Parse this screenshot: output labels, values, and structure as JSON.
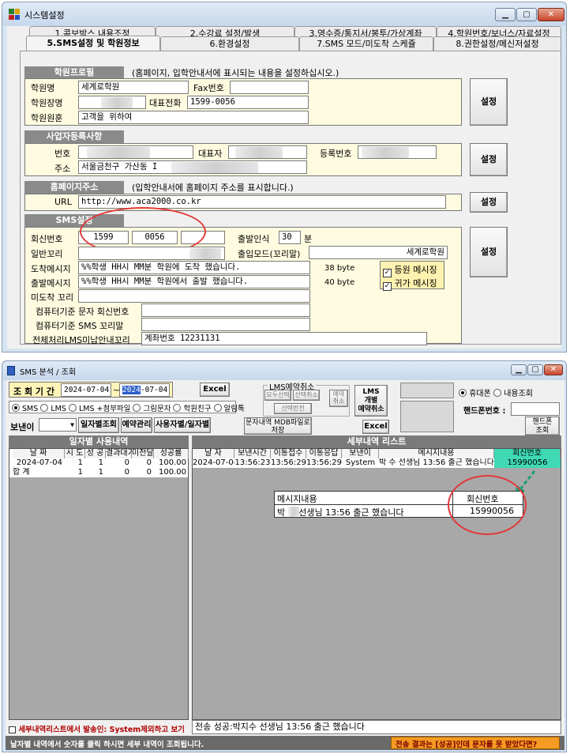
{
  "win1": {
    "title": "시스템설정",
    "tabs_row1": [
      "1.콤보박스 내용조정",
      "2.수강료 설정/발생",
      "3.영수증/통지서/봉투/가상계좌",
      "4.학원번호/보너스/자료설정"
    ],
    "tabs_row2": [
      "5.SMS설정 및 학원정보",
      "6.환경설정",
      "7.SMS 모드/미도착 스케쥴",
      "8.권한설정/메신저설정"
    ],
    "academy": {
      "header": "학원프로필",
      "note": "(홈페이지, 입학안내서에 표시되는 내용을 설정하십시오.)",
      "name_label": "학원명",
      "name_value": "세계로학원",
      "fax_label": "Fax번호",
      "fax_value": "",
      "director_label": "학원장명",
      "phone_label": "대표전화",
      "phone_value": "1599-0056",
      "motto_label": "학원원훈",
      "motto_value": "고객을 위하여",
      "button": "설정"
    },
    "business": {
      "header": "사업자등록사항",
      "number_label": "번호",
      "rep_label": "대표자",
      "reg_label": "등록번호",
      "addr_label": "주소",
      "addr_value": "서울금천구 가산동 I",
      "button": "설정"
    },
    "homepage": {
      "header": "홈페이지주소",
      "note": "(입학안내서에 홈페이지 주소를 표시합니다.)",
      "url_label": "URL",
      "url_value": "http://www.aca2000.co.kr",
      "button": "설정"
    },
    "sms": {
      "header": "SMS설정",
      "callback_label": "회신번호",
      "callback_1": "1599",
      "callback_2": "0056",
      "callback_3": "",
      "out_label": "출발인식",
      "out_value": "30",
      "out_unit": "분",
      "tail_label": "일반꼬리",
      "mode_label": "출입모드(꼬리말)",
      "mode_value": "세계로학원",
      "arrive_label": "도착메시지",
      "arrive_value": "%%학생 HH시 MM분 학원에 도착 했습니다.",
      "arrive_bytes": "38 byte",
      "depart_label": "출발메시지",
      "depart_value": "%%학생 HH시 MM분 학원에서 출발 했습니다.",
      "depart_bytes": "40 byte",
      "check1": "등원 메시징",
      "check2": "귀가 메시징",
      "late_label": "미도착 꼬리",
      "pc_callback_label": "컴퓨터기준 문자 회신번호",
      "pc_tail_label": "컴퓨터기준 SMS 꼬리말",
      "lms_label": "전체처리LMS미납안내꼬리",
      "lms_value": "계좌번호 12231131",
      "button": "설정"
    }
  },
  "win2": {
    "title": "SMS 분석 / 조회",
    "period_label": "조 회 기 간",
    "date_from": "2024-07-04",
    "tilde": "~",
    "date_to_sel": "2024",
    "date_to_rest": "-07-04",
    "excel1": "Excel",
    "lms_group": "LMS예약취소",
    "btn_select_all": "모두선택",
    "btn_select_cancel": "선택취소",
    "btn_reserve_cancel": "예약\n취소",
    "btn_select_reverse": "선택반전",
    "btn_lms": "LMS\n개별\n예약취소",
    "radios": [
      "SMS",
      "LMS",
      "LMS +첨부파일",
      "그림문자",
      "학원친구",
      "알림톡"
    ],
    "sender_label": "보낸이",
    "btn_daily": "일자별조회",
    "btn_reserve": "예약관리",
    "btn_user_daily": "사용자별/일자별",
    "btn_mdb": "문자내역 MDB파일로\n저장",
    "excel2": "Excel",
    "radio_phone": "휴대폰",
    "radio_mine": "내용조회",
    "phone_label": "핸드폰번호 :",
    "btn_phone": "핸드폰\n조회",
    "daily_header": "일자별 사용내역",
    "daily_cols": [
      "날 짜",
      "시 도",
      "성 공",
      "결과대기",
      "미전달",
      "성공률"
    ],
    "daily_rows": [
      [
        "2024-07-04",
        "1",
        "1",
        "0",
        "0",
        "100.00"
      ],
      [
        "합 계",
        "1",
        "1",
        "0",
        "0",
        "100.00"
      ]
    ],
    "detail_header": "세부내역 리스트",
    "detail_cols": [
      "날 자",
      "보낸시간",
      "이통접수",
      "이통응답",
      "보낸이",
      "메시지내용",
      "회신번호"
    ],
    "detail_row": [
      "2024-07-04",
      "13:56:23",
      "13:56:29",
      "13:56:29",
      "System",
      "박  수 선생님 13:56 출근 했습니다",
      "15990056"
    ],
    "popup_msg_head": "메시지내용",
    "popup_cb_head": "회신번호",
    "popup_msg": "박  수 선생님 13:56 출근 했습니다",
    "popup_cb": "15990056",
    "bottom_check": "세부내역리스트에서 발송인: System제외하고 보기",
    "bottom_msg": "전송 성공:박지수 선생님 13:56 출근 했습니다",
    "status_left": "날자별 내역에서 숫자를 클릭 하시면 세부 내역이 조회됩니다.",
    "status_right": "전송 결과는 [성공]인데 문자를 못 받았다면?"
  }
}
